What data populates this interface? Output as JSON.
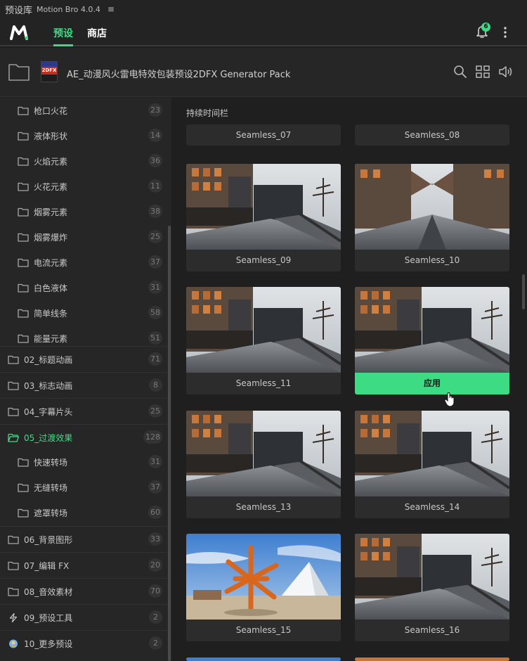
{
  "titlebar": {
    "title_cn": "预设库",
    "app_version": "Motion Bro 4.0.4",
    "menu_glyph": "≡"
  },
  "nav": {
    "tab_presets": "预设",
    "tab_store": "商店",
    "notification_count": "6"
  },
  "pack": {
    "title": "AE_动漫风火雷电特效包装预设2DFX Generator Pack",
    "thumb_text": "2DFX"
  },
  "sidebar": {
    "items": [
      {
        "label": "枪口火花",
        "count": "23",
        "level": "sub"
      },
      {
        "label": "液体形状",
        "count": "14",
        "level": "sub"
      },
      {
        "label": "火焰元素",
        "count": "36",
        "level": "sub"
      },
      {
        "label": "火花元素",
        "count": "11",
        "level": "sub"
      },
      {
        "label": "烟雾元素",
        "count": "38",
        "level": "sub"
      },
      {
        "label": "烟雾爆炸",
        "count": "25",
        "level": "sub"
      },
      {
        "label": "电流元素",
        "count": "37",
        "level": "sub"
      },
      {
        "label": "白色液体",
        "count": "31",
        "level": "sub"
      },
      {
        "label": "简单线条",
        "count": "58",
        "level": "sub"
      },
      {
        "label": "能量元素",
        "count": "51",
        "level": "sub"
      },
      {
        "label": "02_标题动画",
        "count": "71",
        "level": "top"
      },
      {
        "label": "03_标志动画",
        "count": "8",
        "level": "top"
      },
      {
        "label": "04_字幕片头",
        "count": "25",
        "level": "top"
      },
      {
        "label": "05_过渡效果",
        "count": "128",
        "level": "top",
        "active": true
      },
      {
        "label": "快速转场",
        "count": "31",
        "level": "sub"
      },
      {
        "label": "无缝转场",
        "count": "37",
        "level": "sub"
      },
      {
        "label": "遮罩转场",
        "count": "60",
        "level": "sub"
      },
      {
        "label": "06_背景图形",
        "count": "33",
        "level": "top"
      },
      {
        "label": "07_编辑 FX",
        "count": "20",
        "level": "top"
      },
      {
        "label": "08_音效素材",
        "count": "70",
        "level": "top"
      },
      {
        "label": "09_预设工具",
        "count": "2",
        "level": "top",
        "icon": "bolt-icon"
      },
      {
        "label": "10_更多预设",
        "count": "2",
        "level": "top",
        "icon": "avatar-icon"
      }
    ]
  },
  "content": {
    "section_title": "持续时间栏",
    "cards": [
      {
        "label": "Seamless_07",
        "image": "none"
      },
      {
        "label": "Seamless_08",
        "image": "none"
      },
      {
        "label": "Seamless_09",
        "image": "street"
      },
      {
        "label": "Seamless_10",
        "image": "street-mirrored"
      },
      {
        "label": "Seamless_11",
        "image": "street"
      },
      {
        "label": "应用",
        "image": "street",
        "hover": true
      },
      {
        "label": "Seamless_13",
        "image": "street"
      },
      {
        "label": "Seamless_14",
        "image": "street"
      },
      {
        "label": "Seamless_15",
        "image": "sculpture"
      },
      {
        "label": "Seamless_16",
        "image": "street"
      }
    ]
  },
  "colors": {
    "accent": "#3ddc84",
    "background": "#1f1f1f",
    "panel": "#262626",
    "card": "#2c2c2c"
  }
}
